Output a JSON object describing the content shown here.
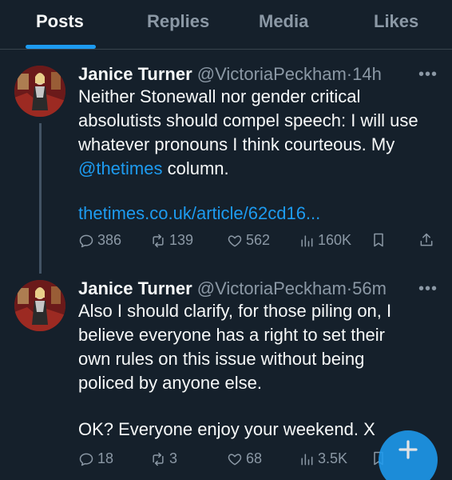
{
  "tabs": [
    {
      "label": "Posts",
      "active": true
    },
    {
      "label": "Replies"
    },
    {
      "label": "Media"
    },
    {
      "label": "Likes"
    }
  ],
  "posts": [
    {
      "author_name": "Janice Turner",
      "handle": "@VictoriaPeckham",
      "time": "·14h",
      "more": "•••",
      "lines": [
        "Neither Stonewall nor gender critical",
        "absolutists should compel speech: I will use",
        "whatever pronouns I think courteous. My"
      ],
      "mention": "@thetimes",
      "after_mention": " column.",
      "url": "thetimes.co.uk/article/62cd16...",
      "stats": {
        "replies": "386",
        "reposts": "139",
        "likes": "562",
        "views": "160K"
      }
    },
    {
      "author_name": "Janice Turner",
      "handle": "@VictoriaPeckham",
      "time": "·56m",
      "more": "•••",
      "lines": [
        "Also I should clarify, for those piling on, I",
        "believe everyone has a right to set their",
        "own rules on this issue without being",
        "policed by anyone else.",
        "",
        "OK? Everyone enjoy your weekend. X"
      ],
      "stats": {
        "replies": "18",
        "reposts": "3",
        "likes": "68",
        "views": "3.5K"
      }
    }
  ],
  "colors": {
    "background": "#15202b",
    "accent": "#1d9bf0",
    "muted": "#8b98a5"
  },
  "icons": [
    "reply-icon",
    "repost-icon",
    "like-icon",
    "views-icon",
    "bookmark-icon",
    "share-icon",
    "compose-plus-icon"
  ]
}
